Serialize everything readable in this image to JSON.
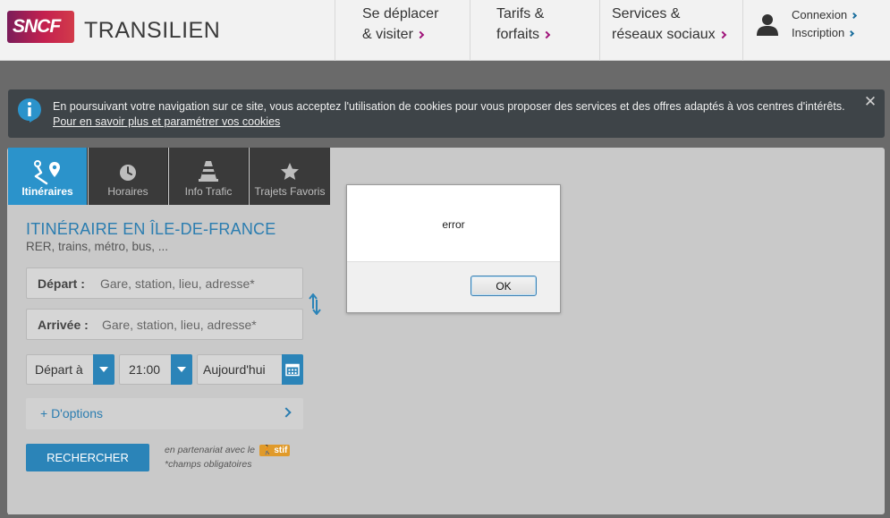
{
  "header": {
    "logo_text": "SNCF",
    "brand_name": "TRANSILIEN",
    "nav": [
      {
        "line1": "Se déplacer",
        "line2": "& visiter"
      },
      {
        "line1": "Tarifs &",
        "line2": "forfaits"
      },
      {
        "line1": "Services &",
        "line2": "réseaux sociaux"
      }
    ],
    "account": {
      "login": "Connexion",
      "signup": "Inscription"
    }
  },
  "cookie": {
    "text": "En poursuivant votre navigation sur ce site, vous acceptez l'utilisation de cookies pour vous proposer des services et des offres adaptés à vos centres d'intérêts.",
    "link": "Pour en savoir plus et paramétrer vos cookies"
  },
  "tabs": [
    {
      "label": "Itinéraires",
      "active": true
    },
    {
      "label": "Horaires",
      "active": false
    },
    {
      "label": "Info Trafic",
      "active": false
    },
    {
      "label": "Trajets Favoris",
      "active": false
    }
  ],
  "form": {
    "title": "ITINÉRAIRE EN ÎLE-DE-FRANCE",
    "subtitle": "RER, trains, métro, bus, ...",
    "depart_label": "Départ :",
    "depart_placeholder": "Gare, station, lieu, adresse*",
    "arrivee_label": "Arrivée :",
    "arrivee_placeholder": "Gare, station, lieu, adresse*",
    "mode": "Départ à",
    "time": "21:00",
    "date": "Aujourd'hui",
    "options": "+ D'options",
    "search": "RECHERCHER",
    "partner_text": "en partenariat avec le",
    "partner_badge": "stif",
    "required_note": "*champs obligatoires"
  },
  "dialog": {
    "message": "error",
    "ok": "OK"
  },
  "colors": {
    "accent_blue": "#2b84b8",
    "brand_purple": "#a0147a",
    "tab_active": "#2b93cb",
    "tab_inactive": "#3a3a3a",
    "banner": "#3e4448"
  }
}
